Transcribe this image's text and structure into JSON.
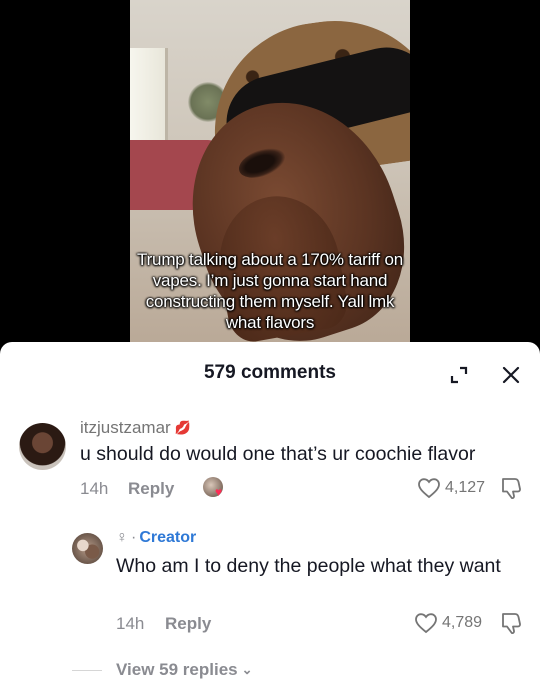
{
  "video": {
    "caption": "Trump talking about a 170% tariff on vapes. I’m just gonna start hand constructing them myself. Yall lmk what flavors"
  },
  "comments_panel": {
    "title": "579 comments",
    "icons": {
      "expand": "expand-icon",
      "close": "close-icon"
    }
  },
  "comments": [
    {
      "username": "itzjustzamar",
      "username_emoji": "💋",
      "text": "u should do would one that’s ur coochie flavor",
      "time": "14h",
      "reply_label": "Reply",
      "likes": "4,127"
    }
  ],
  "reply": {
    "creator_label": "Creator",
    "text": "Who am I to deny the people what they want",
    "time": "14h",
    "reply_label": "Reply",
    "likes": "4,789"
  },
  "view_replies": "View 59 replies",
  "colors": {
    "creator_blue": "#2f79d6",
    "text_dark": "#161823",
    "meta_gray": "#8a8b91"
  }
}
